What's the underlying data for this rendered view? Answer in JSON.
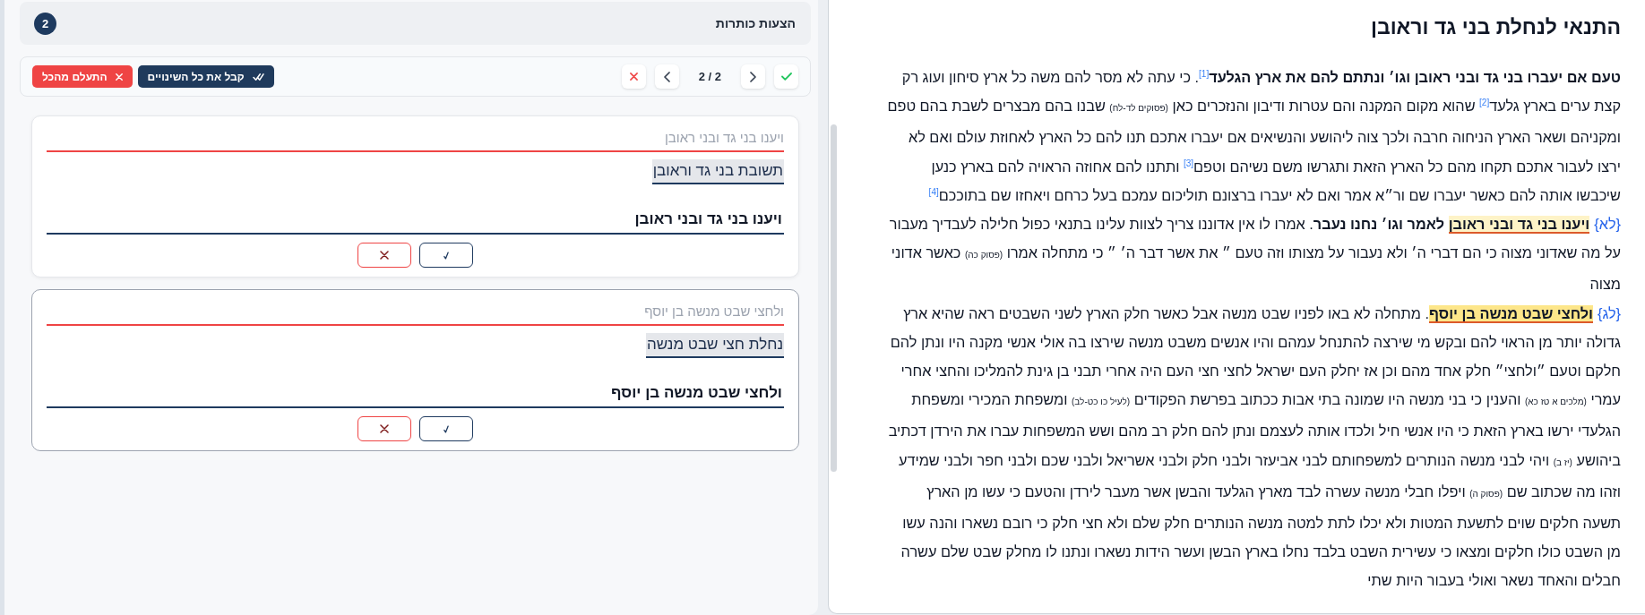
{
  "suggestions_panel": {
    "title": "הצעות כותרות",
    "count": "2"
  },
  "toolbar": {
    "counter": "2 / 2",
    "accept_all": "קבל את כל השינויים",
    "ignore_all": "התעלם מהכל"
  },
  "suggestions": [
    {
      "original": "ויענו בני גד ובני ראובן",
      "suggestion": "תשובת בני גד וראובן",
      "value": "ויענו בני גד ובני ראובן",
      "selected": false
    },
    {
      "original": "ולחצי שבט מנשה בן יוסף",
      "suggestion": "נחלת חצי שבט מנשה",
      "value": "ולחצי שבט מנשה בן יוסף",
      "selected": true
    }
  ],
  "document": {
    "title": "התנאי לנחלת בני גד וראובן",
    "paragraphs": [
      {
        "runs": [
          {
            "kind": "bold",
            "text": "טעם אם יעברו בני גד ובני ראובן וגו׳ ונתתם להם את ארץ הגלעד"
          },
          {
            "kind": "note",
            "text": "[1]"
          },
          {
            "kind": "plain",
            "text": ". כי עתה לא מסר להם משה כל ארץ סיחון ועוג רק קצת ערים בארץ גלעד"
          },
          {
            "kind": "note",
            "text": "[2]"
          },
          {
            "kind": "plain",
            "text": " שהוא מקום המקנה והם עטרות ודיבון והנזכרים כאן "
          },
          {
            "kind": "ref",
            "text": "(פסוקים לד-לח)"
          },
          {
            "kind": "plain",
            "text": " שבנו בהם מבצרים לשבת בהם טפם ומקניהם ושאר הארץ הניחוה חרבה ולכך צוה ליהושע והנשיאים אם יעברו אתכם תנו להם כל הארץ לאחוזת עולם ואם לא ירצו לעבור אתכם תקחו מהם כל הארץ הזאת ותגרשו משם נשיהם וטפם"
          },
          {
            "kind": "note",
            "text": "[3]"
          },
          {
            "kind": "plain",
            "text": " ותתנו להם אחוזה הראויה להם בארץ כנען שיכבשו אותה להם כאשר יעברו שם ור״א אמר ואם לא יעברו ברצונם תוליכום עמכם בעל כרחם ויאחזו שם בתוככם"
          },
          {
            "kind": "note",
            "text": "[4]"
          }
        ]
      },
      {
        "runs": [
          {
            "kind": "verse",
            "text": "{לא}"
          },
          {
            "kind": "heading",
            "text": "ויענו בני גד ובני ראובן",
            "selected": false
          },
          {
            "kind": "bold",
            "text": " לאמר וגו׳ נחנו נעבר"
          },
          {
            "kind": "plain",
            "text": ". אמרו לו אין אדוננו צריך לצוות עלינו בתנאי כפול חלילה לעבדיך מעבור על מה שאדוני מצוה כי הם דברי ה׳ ולא נעבור על מצותו וזה טעם ״ את אשר דבר ה׳ ״ כי מתחלה אמרו "
          },
          {
            "kind": "ref",
            "text": "(פסוק כה)"
          },
          {
            "kind": "plain",
            "text": " כאשר אדוני מצוה"
          }
        ]
      },
      {
        "runs": [
          {
            "kind": "verse",
            "text": "{לג}"
          },
          {
            "kind": "heading",
            "text": "ולחצי שבט מנשה בן יוסף",
            "selected": true
          },
          {
            "kind": "plain",
            "text": ". מתחלה לא באו לפניו שבט מנשה אבל כאשר חלק הארץ לשני השבטים ראה שהיא ארץ גדולה יותר מן הראוי להם ובקש מי שירצה להתנחל עמהם והיו אנשים משבט מנשה שירצו בה אולי אנשי מקנה היו ונתן להם חלקם וטעם ״ולחצי״ חלק אחד מהם וכן אז יחלק העם ישראל לחצי חצי העם היה אחרי תבני בן גינת להמליכו והחצי אחרי עמרי "
          },
          {
            "kind": "ref",
            "text": "(מלכים א טז כא)"
          },
          {
            "kind": "plain",
            "text": " והענין כי בני מנשה היו שמונה בתי אבות ככתוב בפרשת הפקודים "
          },
          {
            "kind": "ref",
            "text": "(לעיל כו כט-לב)"
          },
          {
            "kind": "plain",
            "text": " ומשפחת המכירי ומשפחת הגלעדי ירשו בארץ הזאת כי היו אנשי חיל ולכדו אותה לעצמם ונתן להם חלק רב מהם ושש המשפחות עברו את הירדן דכתיב ביהושע "
          },
          {
            "kind": "ref",
            "text": "(יז ב)"
          },
          {
            "kind": "plain",
            "text": " ויהי לבני מנשה הנותרים למשפחותם לבני אביעזר ולבני חלק ולבני אשריאל ולבני שכם ולבני חפר ולבני שמידע וזהו מה שכתוב שם "
          },
          {
            "kind": "ref",
            "text": "(פסוק ה)"
          },
          {
            "kind": "plain",
            "text": " ויפלו חבלי מנשה עשרה לבד מארץ הגלעד והבשן אשר מעבר לירדן והטעם כי עשו מן הארץ תשעה חלקים שוים לתשעת המטות ולא יכלו לתת למטה מנשה הנותרים חלק שלם ולא חצי חלק כי רובם נשארו והנה עשו מן השבט כולו חלקים ומצאו כי עשירית השבט בלבד נחלו בארץ הבשן ועשר הידות נשארו ונתנו לו מחלק שבט שלם עשרה חבלים והאחד נשאר ואולי בעבור היות שתי"
          }
        ]
      }
    ]
  }
}
